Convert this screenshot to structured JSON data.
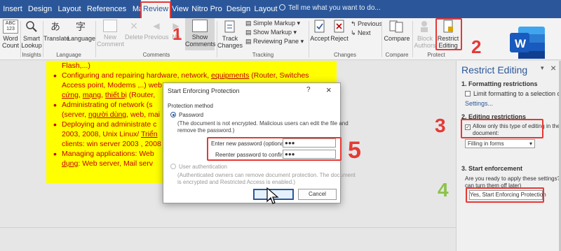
{
  "tabs": [
    "Insert",
    "Design",
    "Layout",
    "References",
    "Mailings",
    "Review",
    "View",
    "Nitro Pro",
    "Design",
    "Layout"
  ],
  "tell_me": "Tell me what you want to do...",
  "ribbon": {
    "word_count": {
      "abc": "ABC",
      "num": "123",
      "label1": "Word",
      "label2": "Count"
    },
    "smart_lookup": {
      "label1": "Smart",
      "label2": "Lookup"
    },
    "translate": "Translate",
    "language": "Language",
    "new_comment": {
      "label1": "New",
      "label2": "Comment"
    },
    "delete": "Delete",
    "previous": "Previous",
    "next": "Ne",
    "show_comments": {
      "label1": "Show",
      "label2": "Comments"
    },
    "track_changes": {
      "label1": "Track",
      "label2": "Changes"
    },
    "simple_markup": "Simple Markup",
    "show_markup": "Show Markup",
    "reviewing_pane": "Reviewing Pane",
    "accept": "Accept",
    "reject": "Reject",
    "prev_change": "Previous",
    "next_change": "Next",
    "compare": "Compare",
    "block_authors": {
      "label1": "Block",
      "label2": "Authors"
    },
    "restrict_editing": {
      "label1": "Restrict",
      "label2": "Editing"
    },
    "groups": {
      "insights": "Insights",
      "language": "Language",
      "comments": "Comments",
      "tracking": "Tracking",
      "changes": "Changes",
      "compare": "Compare",
      "protect": "Protect"
    }
  },
  "document": {
    "line0": "Flash,...)",
    "items": [
      [
        "Configuring and repairing hardware, network, ",
        "equipments",
        " (Router, Switches"
      ],
      [
        "Access point, Modems ,..) web s"
      ],
      [
        "cứng",
        ", ",
        "mạng",
        ", ",
        "thiết bị",
        " (Router,"
      ],
      [
        "Administrating of network (s"
      ],
      [
        "(server, ",
        "người dùng",
        ", web, mai"
      ],
      [
        "Deploying and administrate c"
      ],
      [
        "2003, 2008, Unix Linux/ ",
        "Triển"
      ],
      [
        "clients: win server 2003 , 2008"
      ],
      [
        "Managing applications: Web"
      ],
      [
        "dụng",
        ": Web server, Mail serv"
      ]
    ]
  },
  "pane": {
    "title": "Restrict Editing",
    "close": "×",
    "dropdown_caret": "▾",
    "s1": "1. Formatting restrictions",
    "limit": "Limit formatting to a selection of style",
    "settings": "Settings...",
    "s2": "2. Editing restrictions",
    "allow1": "Allow only this type of editing in the",
    "allow2": "document:",
    "filling": "Filling in forms",
    "s3": "3. Start enforcement",
    "ready1": "Are you ready to apply these settings? (You",
    "ready2": "can turn them off later)",
    "yes_btn": "Yes, Start Enforcing Protection"
  },
  "dialog": {
    "title": "Start Enforcing Protection",
    "help": "?",
    "close": "×",
    "method": "Protection method",
    "password": "Password",
    "pw_note1": "(The document is not encrypted. Malicious users can edit the file and",
    "pw_note2": "remove the password.)",
    "enter_label": "Enter new password (optional):",
    "enter_value": "●●●",
    "reenter_label": "Reenter password to confirm:",
    "reenter_value": "●●●",
    "user_auth": "User authentication",
    "ua_note1": "(Authenticated owners can remove document protection. The document",
    "ua_note2": "is encrypted and Restricted Access is enabled.)",
    "ok": "",
    "cancel": "Cancel"
  },
  "annotations": [
    "1",
    "2",
    "3",
    "4",
    "5"
  ],
  "logo_letter": "W",
  "colors": {
    "word_blue": "#2b579a",
    "highlight": "#ffff00",
    "annotation_red": "#e53935",
    "annotation_green": "#8bc34a",
    "doc_text": "#c00000"
  }
}
